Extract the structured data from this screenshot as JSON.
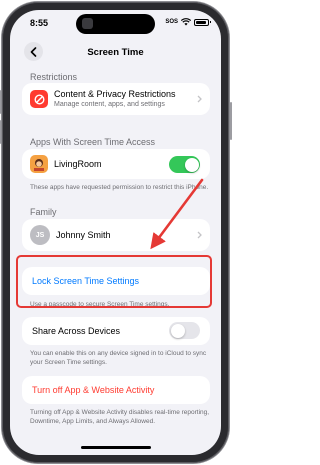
{
  "status_bar": {
    "time": "8:55",
    "carrier": "SOS"
  },
  "nav": {
    "title": "Screen Time"
  },
  "restrictions": {
    "header": "Restrictions",
    "item_title": "Content & Privacy Restrictions",
    "item_subtitle": "Manage content, apps, and settings"
  },
  "apps_access": {
    "header": "Apps With Screen Time Access",
    "app_name": "LivingRoom",
    "toggle_on": true,
    "note": "These apps have requested permission to restrict this iPhone."
  },
  "family": {
    "header": "Family",
    "avatar_initials": "JS",
    "member_name": "Johnny Smith"
  },
  "lock": {
    "label": "Lock Screen Time Settings",
    "note": "Use a passcode to secure Screen Time settings."
  },
  "share": {
    "label": "Share Across Devices",
    "toggle_on": false,
    "note": "You can enable this on any device signed in to iCloud to sync your Screen Time settings."
  },
  "turn_off": {
    "label": "Turn off App & Website Activity",
    "note": "Turning off App & Website Activity disables real-time reporting, Downtime, App Limits, and Always Allowed."
  },
  "colors": {
    "link_blue": "#007aff",
    "destructive_red": "#ff3b30",
    "toggle_green": "#34c759",
    "annotation_red": "#e53935"
  }
}
